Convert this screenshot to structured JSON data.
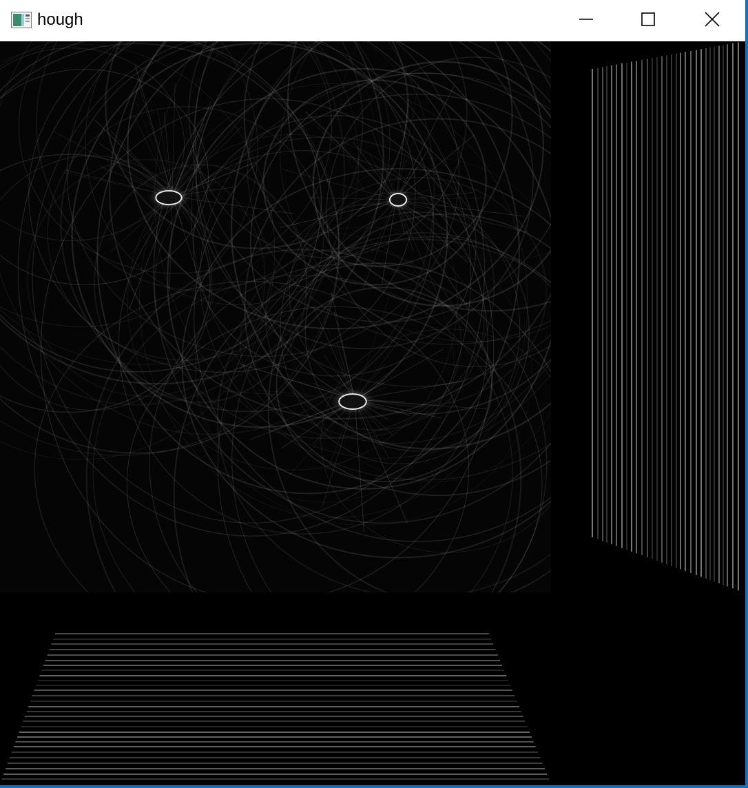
{
  "window": {
    "title": "hough",
    "icon": "image-window-icon",
    "controls": {
      "minimize_icon": "minimize-icon",
      "maximize_icon": "maximize-icon",
      "close_icon": "close-icon"
    },
    "accent_color": "#1a6fb5"
  },
  "panels": {
    "accumulator": {
      "description_icon": "hough-accumulator-image"
    },
    "vertical_profile": {
      "description_icon": "vertical-line-profile-image"
    },
    "horizontal_profile": {
      "description_icon": "horizontal-line-profile-image"
    }
  },
  "colors": {
    "background": "#000000",
    "titlebar": "#ffffff",
    "stroke": "#ffffff"
  }
}
